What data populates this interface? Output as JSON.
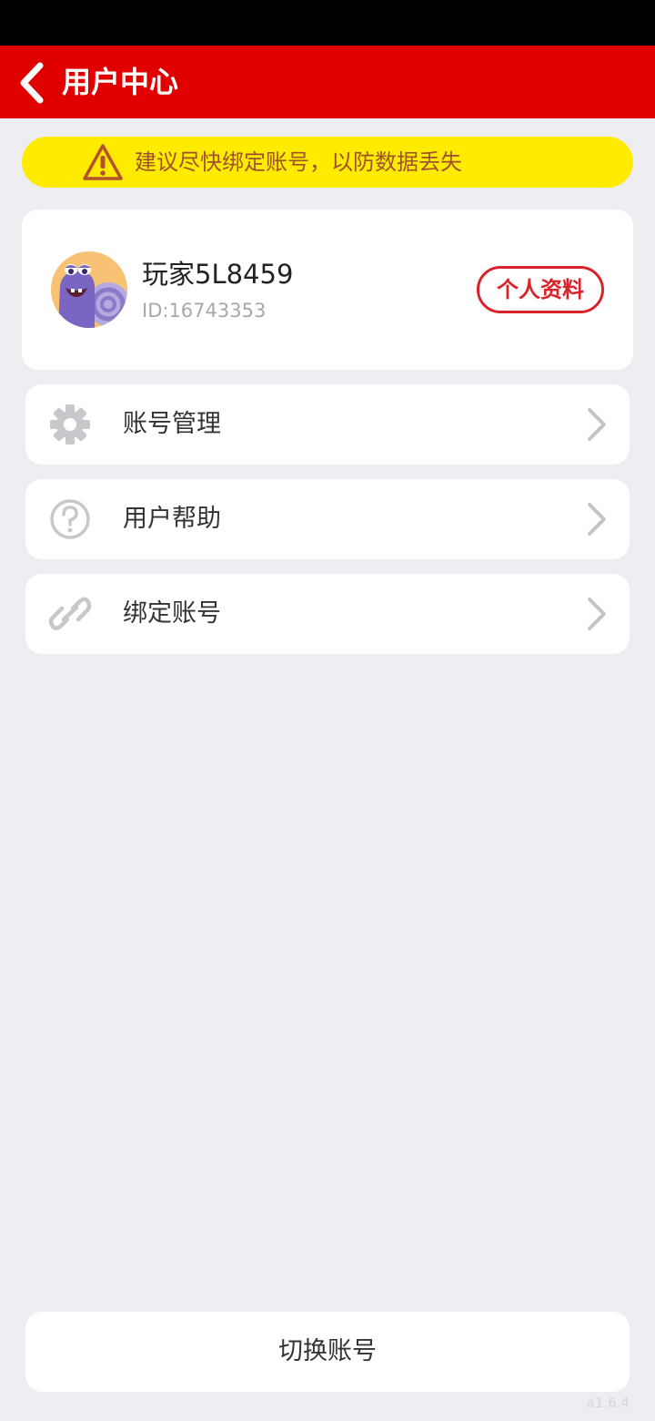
{
  "header": {
    "title": "用户中心",
    "back_icon": "chevron-left-icon",
    "background_color": "#E00000"
  },
  "notice": {
    "icon": "warning-icon",
    "text": "建议尽快绑定账号，以防数据丢失",
    "background_color": "#FFEB00"
  },
  "profile": {
    "avatar": "snail-avatar",
    "nickname": "玩家5L8459",
    "user_id": "ID:16743353",
    "profile_button_label": "个人资料"
  },
  "menu": {
    "items": [
      {
        "label": "账号管理",
        "icon": "gear-icon"
      },
      {
        "label": "用户帮助",
        "icon": "help-circle-icon"
      },
      {
        "label": "绑定账号",
        "icon": "link-icon"
      }
    ]
  },
  "footer": {
    "switch_account_label": "切换账号",
    "version": "a1.6.4"
  }
}
